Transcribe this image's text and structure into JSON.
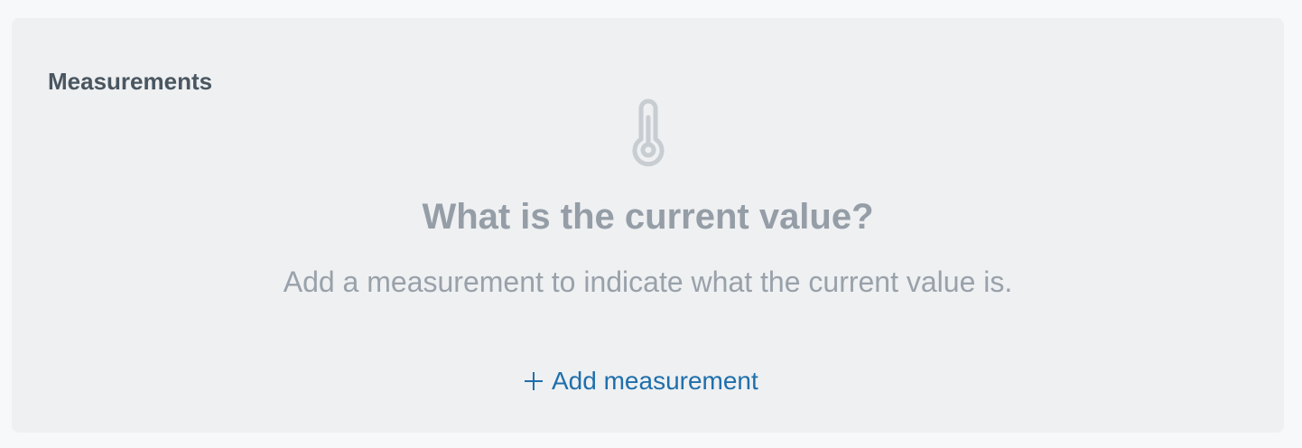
{
  "panel": {
    "title": "Measurements"
  },
  "empty_state": {
    "icon": "thermometer-icon",
    "heading": "What is the current value?",
    "description": "Add a measurement to indicate what the current value is."
  },
  "actions": {
    "add_label": "Add measurement",
    "add_icon": "plus-icon"
  },
  "colors": {
    "panel_bg": "#eef0f2",
    "title": "#4a5660",
    "muted": "#959da6",
    "link": "#1f6fab"
  }
}
